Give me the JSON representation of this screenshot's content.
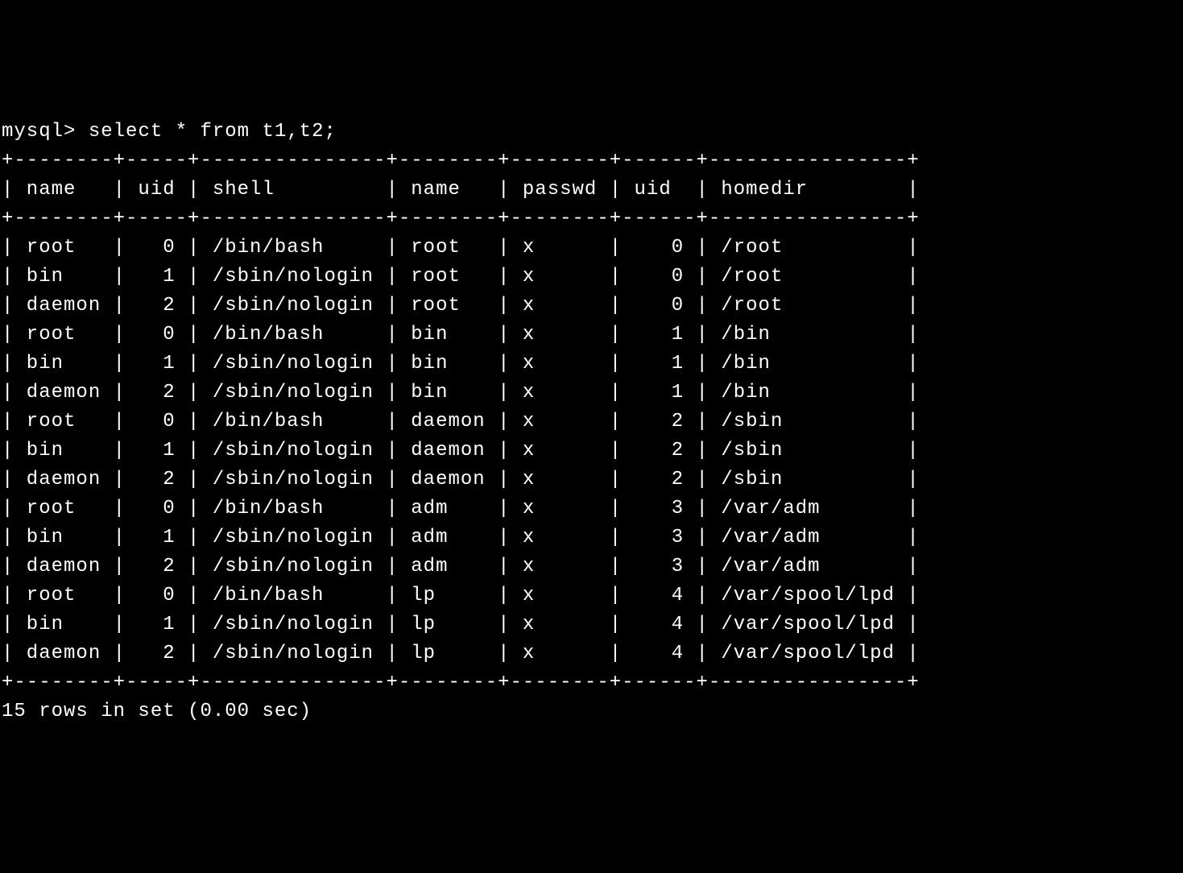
{
  "prompt": "mysql> ",
  "query": "select * from t1,t2;",
  "columns": [
    {
      "name": "name",
      "width": 8,
      "align": "left"
    },
    {
      "name": "uid",
      "width": 5,
      "align": "right"
    },
    {
      "name": "shell",
      "width": 15,
      "align": "left"
    },
    {
      "name": "name",
      "width": 8,
      "align": "left"
    },
    {
      "name": "passwd",
      "width": 8,
      "align": "left"
    },
    {
      "name": "uid",
      "width": 6,
      "align": "right"
    },
    {
      "name": "homedir",
      "width": 16,
      "align": "left"
    }
  ],
  "rows": [
    [
      "root",
      "0",
      "/bin/bash",
      "root",
      "x",
      "0",
      "/root"
    ],
    [
      "bin",
      "1",
      "/sbin/nologin",
      "root",
      "x",
      "0",
      "/root"
    ],
    [
      "daemon",
      "2",
      "/sbin/nologin",
      "root",
      "x",
      "0",
      "/root"
    ],
    [
      "root",
      "0",
      "/bin/bash",
      "bin",
      "x",
      "1",
      "/bin"
    ],
    [
      "bin",
      "1",
      "/sbin/nologin",
      "bin",
      "x",
      "1",
      "/bin"
    ],
    [
      "daemon",
      "2",
      "/sbin/nologin",
      "bin",
      "x",
      "1",
      "/bin"
    ],
    [
      "root",
      "0",
      "/bin/bash",
      "daemon",
      "x",
      "2",
      "/sbin"
    ],
    [
      "bin",
      "1",
      "/sbin/nologin",
      "daemon",
      "x",
      "2",
      "/sbin"
    ],
    [
      "daemon",
      "2",
      "/sbin/nologin",
      "daemon",
      "x",
      "2",
      "/sbin"
    ],
    [
      "root",
      "0",
      "/bin/bash",
      "adm",
      "x",
      "3",
      "/var/adm"
    ],
    [
      "bin",
      "1",
      "/sbin/nologin",
      "adm",
      "x",
      "3",
      "/var/adm"
    ],
    [
      "daemon",
      "2",
      "/sbin/nologin",
      "adm",
      "x",
      "3",
      "/var/adm"
    ],
    [
      "root",
      "0",
      "/bin/bash",
      "lp",
      "x",
      "4",
      "/var/spool/lpd"
    ],
    [
      "bin",
      "1",
      "/sbin/nologin",
      "lp",
      "x",
      "4",
      "/var/spool/lpd"
    ],
    [
      "daemon",
      "2",
      "/sbin/nologin",
      "lp",
      "x",
      "4",
      "/var/spool/lpd"
    ]
  ],
  "footer": "15 rows in set (0.00 sec)"
}
